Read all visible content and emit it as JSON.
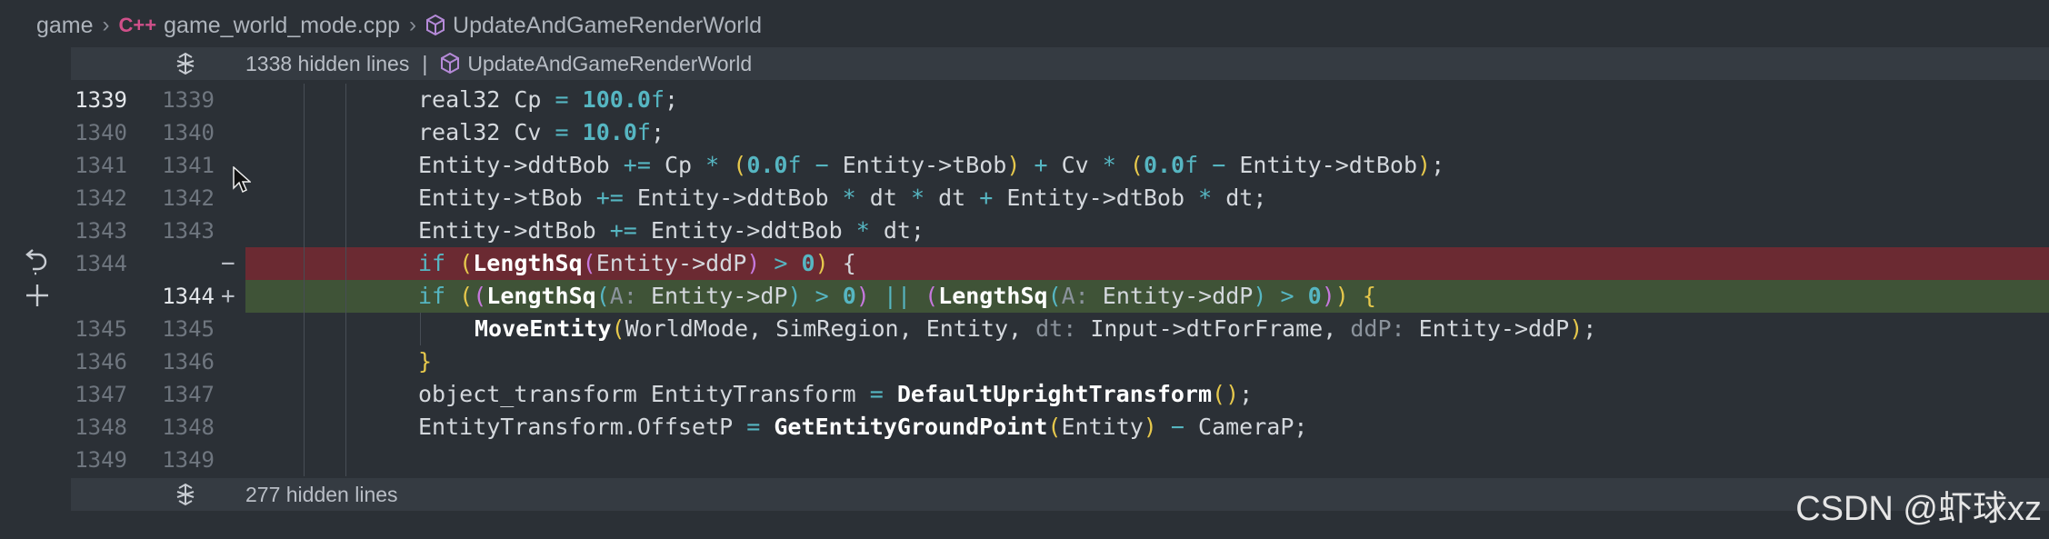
{
  "breadcrumb": {
    "folder": "game",
    "file": "game_world_mode.cpp",
    "file_icon": "C++",
    "symbol": "UpdateAndGameRenderWorld"
  },
  "hidden_top": {
    "text": "1338 hidden lines",
    "separator": "|",
    "symbol": "UpdateAndGameRenderWorld"
  },
  "hidden_bottom": {
    "text": "277 hidden lines"
  },
  "lines": [
    {
      "ln1": "1339",
      "ln2": "1339"
    },
    {
      "ln1": "1340",
      "ln2": "1340"
    },
    {
      "ln1": "1341",
      "ln2": "1341"
    },
    {
      "ln1": "1342",
      "ln2": "1342"
    },
    {
      "ln1": "1343",
      "ln2": "1343"
    },
    {
      "ln1": "1344",
      "ln2": "",
      "mark": "−"
    },
    {
      "ln1": "",
      "ln2": "1344",
      "mark": "+"
    },
    {
      "ln1": "1345",
      "ln2": "1345"
    },
    {
      "ln1": "1346",
      "ln2": "1346"
    },
    {
      "ln1": "1347",
      "ln2": "1347"
    },
    {
      "ln1": "1348",
      "ln2": "1348"
    },
    {
      "ln1": "1349",
      "ln2": "1349"
    }
  ],
  "code": {
    "l1339": {
      "type": "real32",
      "var": "Cp",
      "eq": "=",
      "num": "100.0",
      "suffix": "f",
      "semi": ";"
    },
    "l1340": {
      "type": "real32",
      "var": "Cv",
      "eq": "=",
      "num": "10.0",
      "suffix": "f",
      "semi": ";"
    },
    "l1341": {
      "a": "Entity->ddtBob",
      "op1": "+=",
      "b": "Cp",
      "mul1": "*",
      "p1": "(",
      "n1": "0.0",
      "f1": "f",
      "minus1": "−",
      "c": "Entity->tBob",
      "p1c": ")",
      "plus": "+",
      "d": "Cv",
      "mul2": "*",
      "p2": "(",
      "n2": "0.0",
      "f2": "f",
      "minus2": "−",
      "e": "Entity->dtBob",
      "p2c": ")",
      "semi": ";"
    },
    "l1342": {
      "a": "Entity->tBob",
      "op1": "+=",
      "b": "Entity->ddtBob",
      "mul1": "*",
      "c": "dt",
      "mul2": "*",
      "d": "dt",
      "plus": "+",
      "e": "Entity->dtBob",
      "mul3": "*",
      "f": "dt;"
    },
    "l1343": {
      "a": "Entity->dtBob",
      "op1": "+=",
      "b": "Entity->ddtBob",
      "mul1": "*",
      "c": "dt;"
    },
    "l1344_old": {
      "kw": "if",
      "p1": "(",
      "fn": "LengthSq",
      "p2": "(",
      "arg": "Entity->ddP",
      "p2c": ")",
      "gt": ">",
      "zero": "0",
      "p1c": ")",
      "brace": "{"
    },
    "l1344_new": {
      "kw": "if",
      "p1": "(",
      "p2": "(",
      "fn1": "LengthSq",
      "p3": "(",
      "hint1": "A:",
      "arg1": "Entity->dP",
      "p3c": ")",
      "gt1": ">",
      "zero1": "0",
      "p2c": ")",
      "or": "||",
      "p4": "(",
      "fn2": "LengthSq",
      "p5": "(",
      "hint2": "A:",
      "arg2": "Entity->ddP",
      "p5c": ")",
      "gt2": ">",
      "zero2": "0",
      "p4c": ")",
      "p1c": ")",
      "brace": "{"
    },
    "l1345": {
      "fn": "MoveEntity",
      "p": "(",
      "args": "WorldMode, SimRegion, Entity, ",
      "hint1": "dt:",
      "arg1": "Input->dtForFrame,",
      "hint2": "ddP:",
      "arg2": "Entity->ddP",
      "pc": ")",
      "semi": ";"
    },
    "l1346": {
      "brace": "}"
    },
    "l1347": {
      "type": "object_transform",
      "var": "EntityTransform",
      "eq": "=",
      "fn": "DefaultUprightTransform",
      "p": "(",
      "pc": ")",
      "semi": ";"
    },
    "l1348": {
      "a": "EntityTransform.OffsetP",
      "eq": "=",
      "fn": "GetEntityGroundPoint",
      "p": "(",
      "arg": "Entity",
      "pc": ")",
      "minus": "−",
      "b": "CameraP;"
    }
  },
  "watermark": "CSDN @虾球xz"
}
